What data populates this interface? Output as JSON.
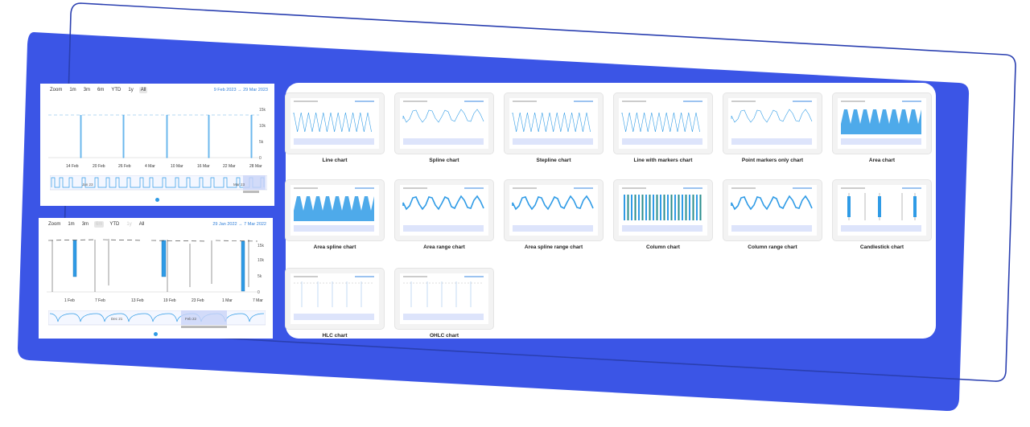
{
  "colors": {
    "accent_blue": "#3b55e6",
    "outline": "#2a3fb0",
    "series": "#2f9be6",
    "nav_fill": "#c9d3f8"
  },
  "stock_top": {
    "range_buttons": [
      "Zoom",
      "1m",
      "3m",
      "6m",
      "YTD",
      "1y",
      "All"
    ],
    "date_from": "9 Feb 2023",
    "arrow": "→",
    "date_to": "29 Mar 2023",
    "y_ticks": [
      "15k",
      "10k",
      "5k",
      "0"
    ],
    "x_ticks": [
      "14 Feb",
      "20 Feb",
      "26 Feb",
      "4 Mar",
      "10 Mar",
      "16 Mar",
      "22 Mar",
      "28 Mar"
    ],
    "nav_labels": [
      "Jan 23",
      "Mar 23"
    ],
    "spike_dates": [
      "15 Feb",
      "25 Feb",
      "8 Mar",
      "18 Mar",
      "28 Mar"
    ]
  },
  "stock_bottom": {
    "range_buttons": [
      "Zoom",
      "1m",
      "3m",
      "6m",
      "YTD",
      "1y",
      "All"
    ],
    "date_from": "29 Jan 2022",
    "arrow": "→",
    "date_to": "7 Mar 2022",
    "y_ticks": [
      "15k",
      "10k",
      "5k",
      "0"
    ],
    "x_ticks": [
      "1 Feb",
      "7 Feb",
      "13 Feb",
      "19 Feb",
      "23 Feb",
      "1 Mar",
      "7 Mar"
    ],
    "nav_labels": [
      "Dec 21",
      "Feb 22"
    ]
  },
  "gallery": {
    "cards": [
      {
        "label": "Line chart",
        "icon": "line-chart-thumbnail"
      },
      {
        "label": "Spline chart",
        "icon": "spline-chart-thumbnail"
      },
      {
        "label": "Stepline chart",
        "icon": "stepline-chart-thumbnail"
      },
      {
        "label": "Line with markers chart",
        "icon": "line-markers-chart-thumbnail"
      },
      {
        "label": "Point markers only chart",
        "icon": "point-markers-chart-thumbnail"
      },
      {
        "label": "Area chart",
        "icon": "area-chart-thumbnail"
      },
      {
        "label": "Area spline chart",
        "icon": "area-spline-chart-thumbnail"
      },
      {
        "label": "Area range chart",
        "icon": "area-range-chart-thumbnail"
      },
      {
        "label": "Area spline range chart",
        "icon": "area-spline-range-chart-thumbnail"
      },
      {
        "label": "Column chart",
        "icon": "column-chart-thumbnail"
      },
      {
        "label": "Column range chart",
        "icon": "column-range-chart-thumbnail"
      },
      {
        "label": "Candlestick chart",
        "icon": "candlestick-chart-thumbnail"
      },
      {
        "label": "HLC chart",
        "icon": "hlc-chart-thumbnail"
      },
      {
        "label": "OHLC chart",
        "icon": "ohlc-chart-thumbnail"
      }
    ]
  }
}
